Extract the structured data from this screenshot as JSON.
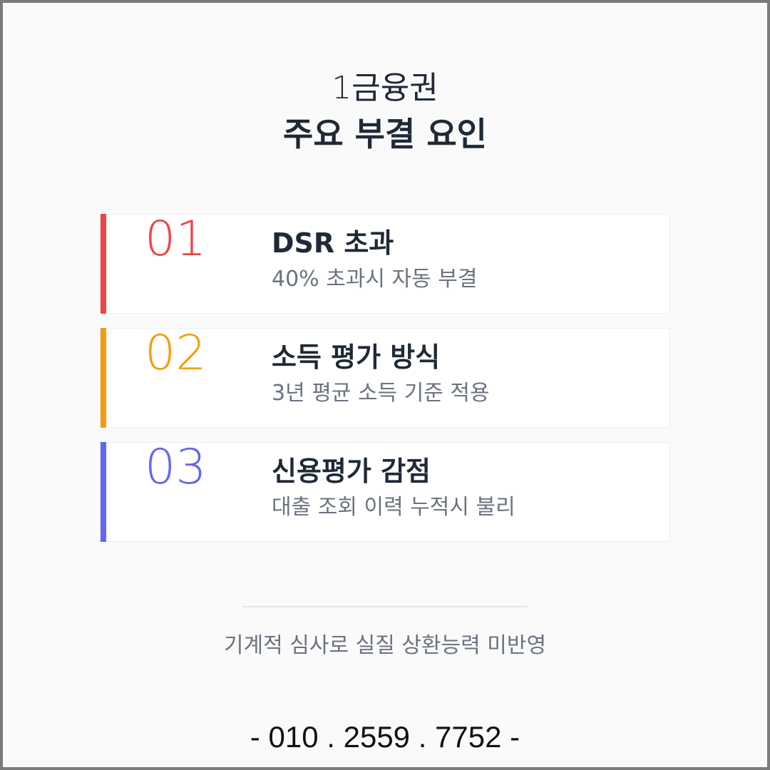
{
  "header": {
    "subtitle": "1금융권",
    "title": "주요 부결 요인"
  },
  "cards": [
    {
      "number": "01",
      "title": "DSR 초과",
      "description": "40% 초과시 자동 부결",
      "accent_color": "#ef4444"
    },
    {
      "number": "02",
      "title": "소득 평가 방식",
      "description": "3년 평균 소득 기준 적용",
      "accent_color": "#f59e0b"
    },
    {
      "number": "03",
      "title": "신용평가 감점",
      "description": "대출 조회 이력 누적시 불리",
      "accent_color": "#6366f1"
    }
  ],
  "footnote": "기계적 심사로 실질 상환능력 미반영",
  "contact": {
    "phone": "- 010 . 2559 . 7752 -"
  }
}
